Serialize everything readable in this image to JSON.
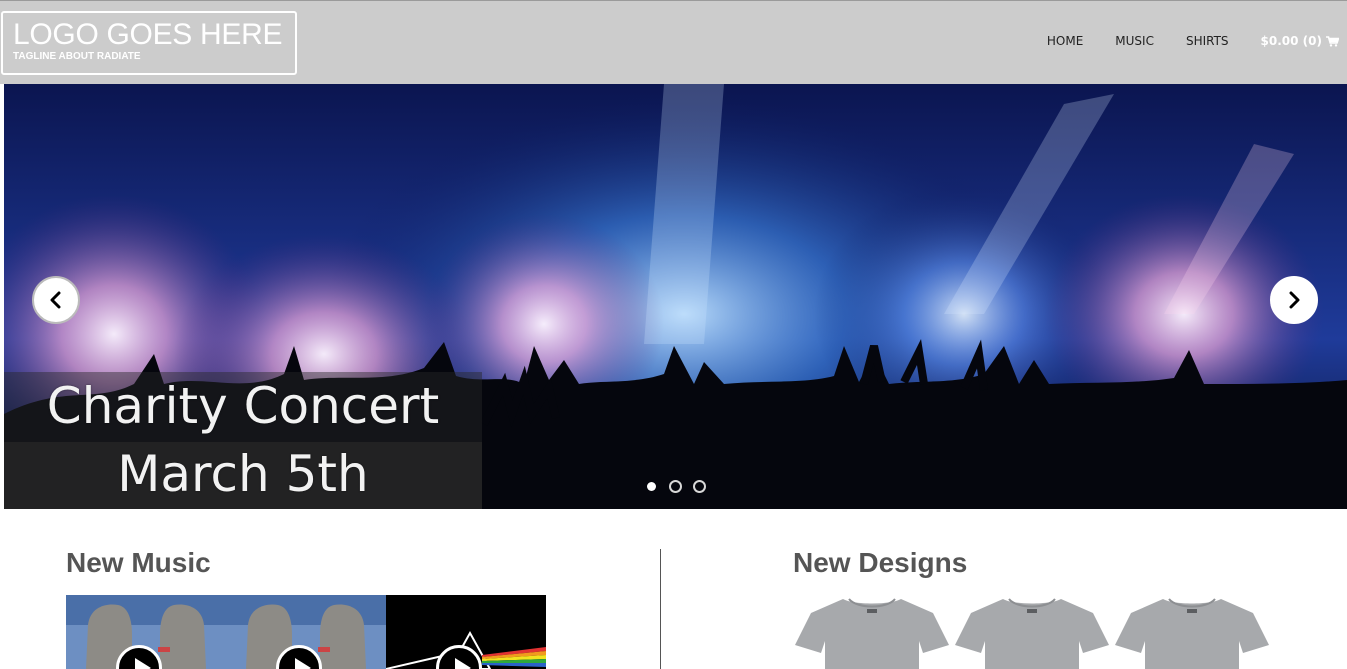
{
  "header": {
    "logo_text": "LOGO GOES HERE",
    "tagline": "TAGLINE ABOUT RADIATE"
  },
  "nav": {
    "items": [
      {
        "label": "HOME"
      },
      {
        "label": "MUSIC"
      },
      {
        "label": "SHIRTS"
      }
    ],
    "cart_label": "$0.00 (0)",
    "cart_icon": "shopping-cart-icon"
  },
  "hero": {
    "caption_line1": "Charity Concert",
    "caption_line2": "March 5th",
    "prev_icon": "chevron-left-icon",
    "next_icon": "chevron-right-icon",
    "slide_count": 3,
    "active_slide": 1
  },
  "sections": {
    "music_title": "New Music",
    "designs_title": "New Designs"
  },
  "albums": [
    {
      "art": "division-bell-heads",
      "icon": "play-icon"
    },
    {
      "art": "division-bell-heads",
      "icon": "play-icon"
    },
    {
      "art": "prism-rainbow",
      "icon": "play-icon"
    }
  ],
  "shirts": [
    {
      "color": "#a7a9ac"
    },
    {
      "color": "#a7a9ac"
    },
    {
      "color": "#a7a9ac"
    }
  ],
  "colors": {
    "header_bg": "#cccccc",
    "logo_text": "#ffffff",
    "nav_text": "#222222",
    "section_title": "#555555"
  }
}
